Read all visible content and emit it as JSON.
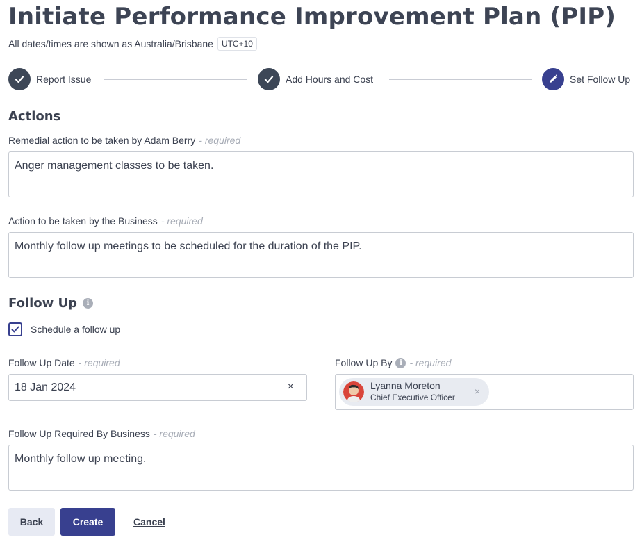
{
  "page": {
    "title": "Initiate Performance Improvement Plan (PIP)",
    "timezone_note": "All dates/times are shown as Australia/Brisbane",
    "timezone_badge": "UTC+10"
  },
  "stepper": {
    "steps": [
      {
        "label": "Report Issue",
        "state": "complete",
        "icon": "check-icon"
      },
      {
        "label": "Add Hours and Cost",
        "state": "complete",
        "icon": "check-icon"
      },
      {
        "label": "Set Follow Up",
        "state": "active",
        "icon": "pencil-icon"
      }
    ]
  },
  "actions": {
    "heading": "Actions",
    "remedial": {
      "label": "Remedial action to be taken by Adam Berry",
      "required": "- required",
      "value": "Anger management classes to be taken."
    },
    "business": {
      "label": "Action to be taken by the Business",
      "required": "- required",
      "value": "Monthly follow up meetings to be scheduled for the duration of the PIP."
    }
  },
  "follow_up": {
    "heading": "Follow Up",
    "checkbox_label": "Schedule a follow up",
    "checked": true,
    "date": {
      "label": "Follow Up Date",
      "required": "- required",
      "value": "18 Jan 2024",
      "clear_symbol": "×"
    },
    "by": {
      "label": "Follow Up By",
      "required": "- required",
      "person_name": "Lyanna Moreton",
      "person_role": "Chief Executive Officer",
      "remove_symbol": "×"
    },
    "required_by_business": {
      "label": "Follow Up Required By Business",
      "required": "- required",
      "value": "Monthly follow up meeting."
    }
  },
  "buttons": {
    "back": "Back",
    "create": "Create",
    "cancel": "Cancel"
  },
  "colors": {
    "primary": "#38408f",
    "complete_step": "#3d4757",
    "secondary_button": "#e7eaf3",
    "required_text": "#a7acb6"
  }
}
